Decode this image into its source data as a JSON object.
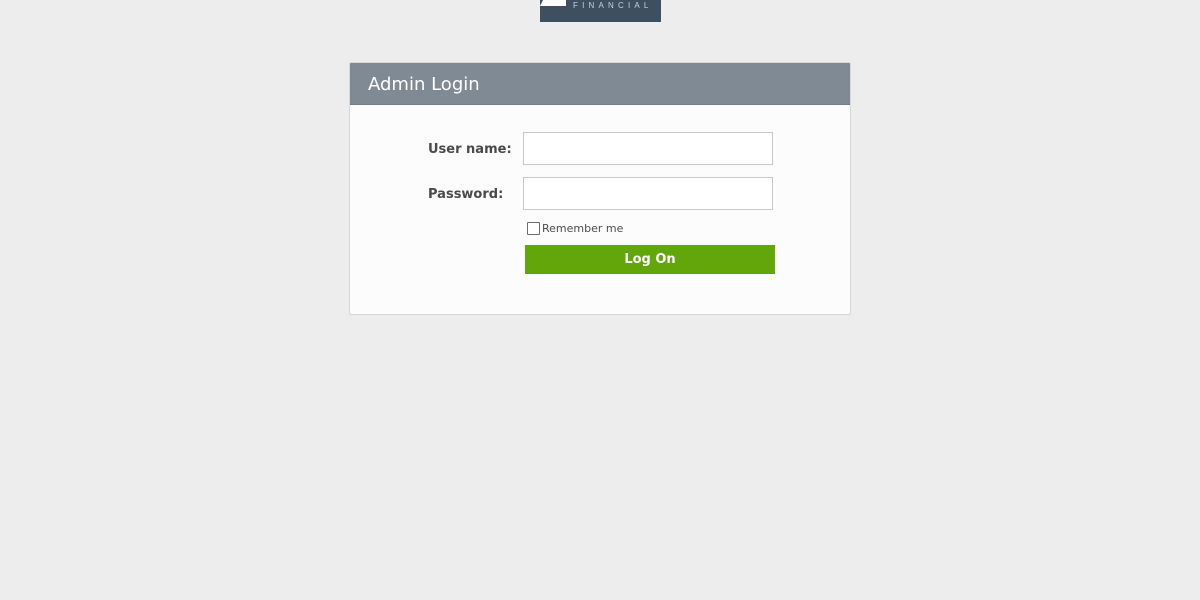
{
  "brand": {
    "logo_text": "FINANCIAL",
    "logo_color": "#3e4f62"
  },
  "login_panel": {
    "title": "Admin Login",
    "header_color": "#7f8a94",
    "username_label": "User name:",
    "username_value": "",
    "password_label": "Password:",
    "password_value": "",
    "remember_label": "Remember me",
    "remember_checked": false,
    "submit_label": "Log On",
    "submit_color": "#62a60a"
  }
}
